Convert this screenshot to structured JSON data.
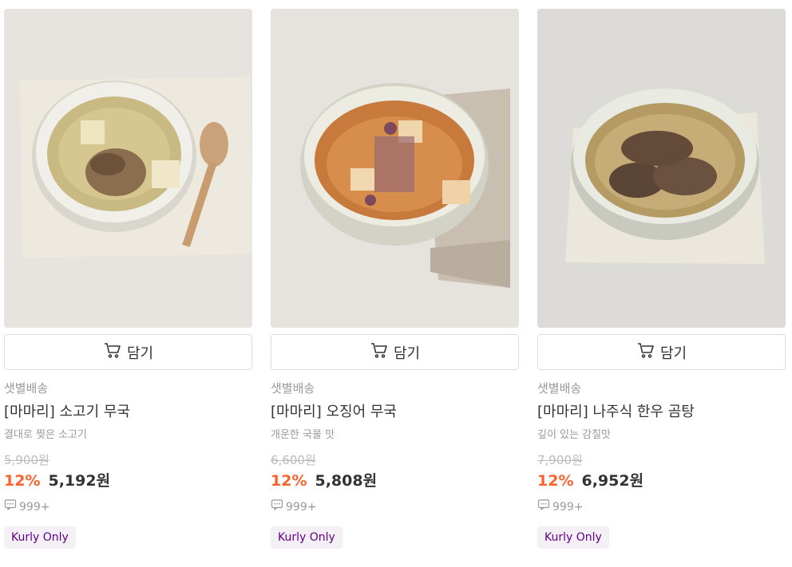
{
  "products": [
    {
      "image_alt": "소고기 무국",
      "cart_label": "담기",
      "delivery": "샛별배송",
      "name": "[마마리] 소고기 무국",
      "desc": "결대로 찢은 소고기",
      "original_price": "5,900원",
      "discount": "12%",
      "price": "5,192원",
      "reviews": "999+",
      "badge": "Kurly Only"
    },
    {
      "image_alt": "오징어 무국",
      "cart_label": "담기",
      "delivery": "샛별배송",
      "name": "[마마리] 오징어 무국",
      "desc": "개운한 국물 맛",
      "original_price": "6,600원",
      "discount": "12%",
      "price": "5,808원",
      "reviews": "999+",
      "badge": "Kurly Only"
    },
    {
      "image_alt": "나주식 한우 곰탕",
      "cart_label": "담기",
      "delivery": "샛별배송",
      "name": "[마마리] 나주식 한우 곰탕",
      "desc": "깊이 있는 감칠맛",
      "original_price": "7,900원",
      "discount": "12%",
      "price": "6,952원",
      "reviews": "999+",
      "badge": "Kurly Only"
    }
  ],
  "colors": {
    "discount": "#fa622f",
    "badge_text": "#5f0080",
    "badge_bg": "#f4f0f6"
  },
  "icons": [
    "cart-icon",
    "comment-icon"
  ]
}
